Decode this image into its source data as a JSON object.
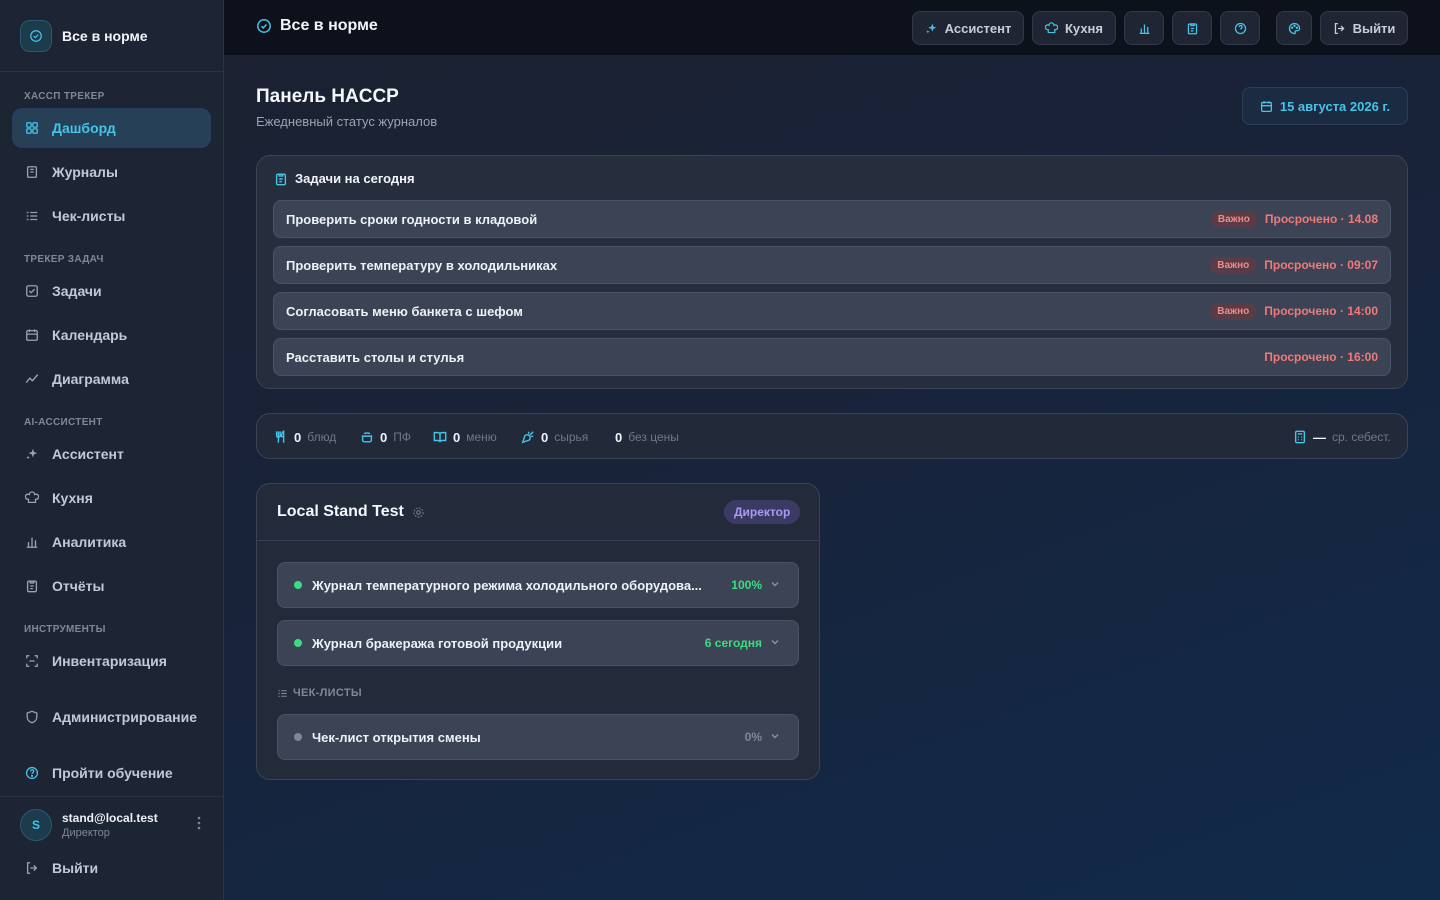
{
  "app": {
    "brand_name": "Все в норме"
  },
  "sidebar": {
    "sections": [
      {
        "title": "ХАССП ТРЕКЕР"
      },
      {
        "title": "ТРЕКЕР ЗАДАЧ"
      },
      {
        "title": "AI-АССИСТЕНТ"
      },
      {
        "title": "ИНСТРУМЕНТЫ"
      }
    ],
    "items": [
      {
        "label": "Дашборд",
        "icon": "dashboard-grid-icon",
        "active": true
      },
      {
        "label": "Журналы",
        "icon": "journal-book-icon"
      },
      {
        "label": "Чек-листы",
        "icon": "checklist-icon"
      },
      {
        "label": "Задачи",
        "icon": "task-checkbox-icon"
      },
      {
        "label": "Календарь",
        "icon": "calendar-icon"
      },
      {
        "label": "Диаграмма",
        "icon": "line-chart-icon"
      },
      {
        "label": "Ассистент",
        "icon": "sparkles-icon"
      },
      {
        "label": "Кухня",
        "icon": "chef-hat-icon"
      },
      {
        "label": "Аналитика",
        "icon": "bar-chart-icon"
      },
      {
        "label": "Отчёты",
        "icon": "report-clipboard-icon"
      },
      {
        "label": "Инвентаризация",
        "icon": "inventory-scan-icon"
      },
      {
        "label": "Администрирование",
        "icon": "shield-icon"
      },
      {
        "label": "Пройти обучение",
        "icon": "help-circle-icon"
      }
    ],
    "user": {
      "avatar_letter": "S",
      "email": "stand@local.test",
      "role": "Директор"
    },
    "logout_label": "Выйти"
  },
  "topbar": {
    "title": "Все в норме",
    "assistant_label": "Ассистент",
    "kitchen_label": "Кухня",
    "logout_label": "Выйти"
  },
  "page": {
    "title": "Панель HACCP",
    "subtitle": "Ежедневный статус журналов",
    "date": "15 августа 2026 г."
  },
  "tasks": {
    "title": "Задачи на сегодня",
    "important_label": "Важно",
    "items": [
      {
        "title": "Проверить сроки годности в кладовой",
        "important": true,
        "status": "Просрочено · 14.08"
      },
      {
        "title": "Проверить температуру в холодильниках",
        "important": true,
        "status": "Просрочено · 09:07"
      },
      {
        "title": "Согласовать меню банкета с шефом",
        "important": true,
        "status": "Просрочено · 14:00"
      },
      {
        "title": "Расставить столы и стулья",
        "important": false,
        "status": "Просрочено · 16:00"
      }
    ]
  },
  "stats": {
    "dishes": {
      "value": "0",
      "label": "блюд"
    },
    "semi": {
      "value": "0",
      "label": "ПФ"
    },
    "menus": {
      "value": "0",
      "label": "меню"
    },
    "raw": {
      "value": "0",
      "label": "сырья"
    },
    "unpriced": {
      "value": "0",
      "label": "без цены"
    },
    "avg_cost": {
      "value": "—",
      "label": "ср. себест."
    }
  },
  "organization": {
    "name": "Local Stand Test",
    "role": "Директор",
    "journals": [
      {
        "title": "Журнал температурного режима холодильного оборудова...",
        "value": "100%",
        "color": "#3ddc84"
      },
      {
        "title": "Журнал бракеража готовой продукции",
        "value": "6 сегодня",
        "color": "#3ddc84"
      }
    ],
    "checklists_label": "ЧЕК-ЛИСТЫ",
    "checklists": [
      {
        "title": "Чек-лист открытия смены",
        "value": "0%",
        "color": "#7f8899"
      }
    ]
  },
  "colors": {
    "accent": "#45c4e8",
    "danger": "#f07a7a",
    "success": "#3ddc84",
    "role": "#a89bf2"
  }
}
